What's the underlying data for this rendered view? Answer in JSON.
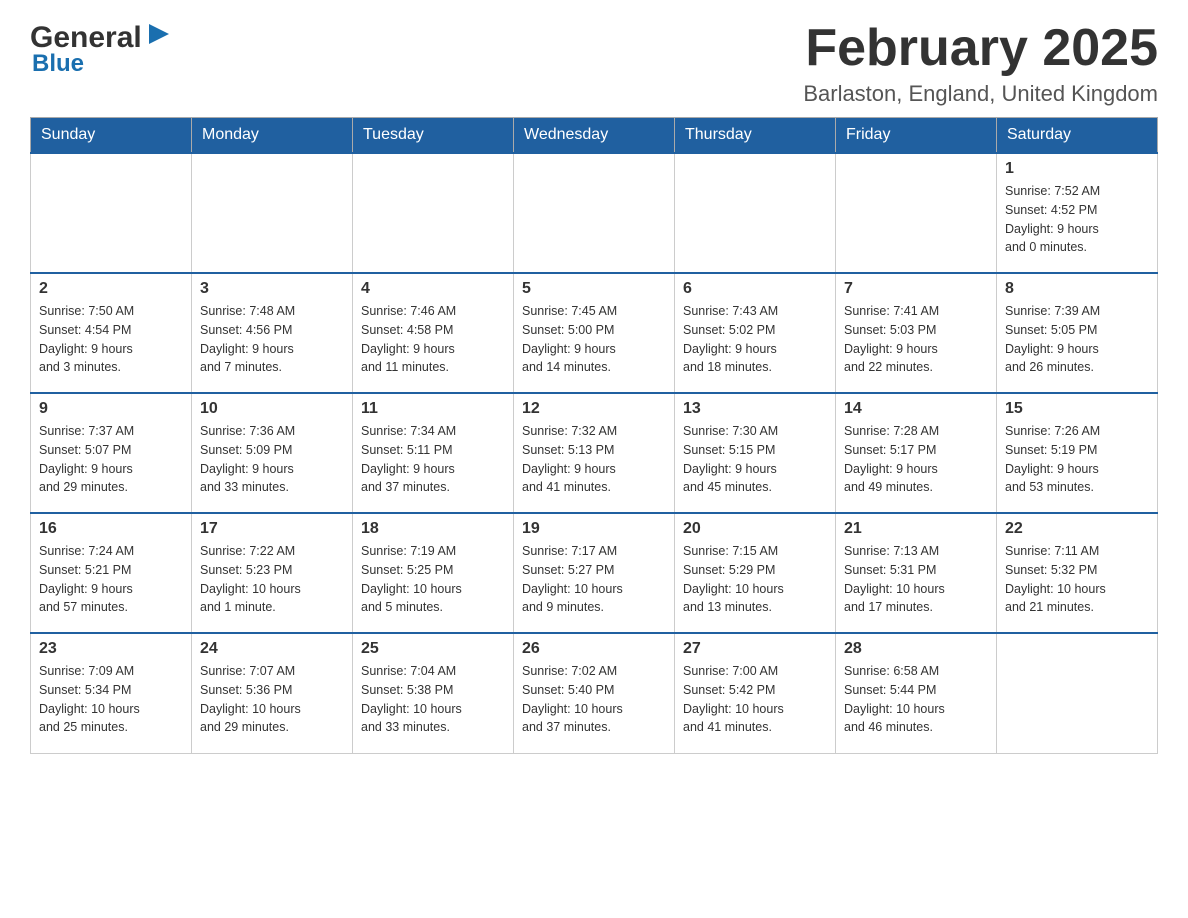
{
  "header": {
    "logo_general": "General",
    "logo_blue": "Blue",
    "month_title": "February 2025",
    "location": "Barlaston, England, United Kingdom"
  },
  "days_of_week": [
    "Sunday",
    "Monday",
    "Tuesday",
    "Wednesday",
    "Thursday",
    "Friday",
    "Saturday"
  ],
  "weeks": [
    [
      {
        "day": "",
        "info": ""
      },
      {
        "day": "",
        "info": ""
      },
      {
        "day": "",
        "info": ""
      },
      {
        "day": "",
        "info": ""
      },
      {
        "day": "",
        "info": ""
      },
      {
        "day": "",
        "info": ""
      },
      {
        "day": "1",
        "info": "Sunrise: 7:52 AM\nSunset: 4:52 PM\nDaylight: 9 hours\nand 0 minutes."
      }
    ],
    [
      {
        "day": "2",
        "info": "Sunrise: 7:50 AM\nSunset: 4:54 PM\nDaylight: 9 hours\nand 3 minutes."
      },
      {
        "day": "3",
        "info": "Sunrise: 7:48 AM\nSunset: 4:56 PM\nDaylight: 9 hours\nand 7 minutes."
      },
      {
        "day": "4",
        "info": "Sunrise: 7:46 AM\nSunset: 4:58 PM\nDaylight: 9 hours\nand 11 minutes."
      },
      {
        "day": "5",
        "info": "Sunrise: 7:45 AM\nSunset: 5:00 PM\nDaylight: 9 hours\nand 14 minutes."
      },
      {
        "day": "6",
        "info": "Sunrise: 7:43 AM\nSunset: 5:02 PM\nDaylight: 9 hours\nand 18 minutes."
      },
      {
        "day": "7",
        "info": "Sunrise: 7:41 AM\nSunset: 5:03 PM\nDaylight: 9 hours\nand 22 minutes."
      },
      {
        "day": "8",
        "info": "Sunrise: 7:39 AM\nSunset: 5:05 PM\nDaylight: 9 hours\nand 26 minutes."
      }
    ],
    [
      {
        "day": "9",
        "info": "Sunrise: 7:37 AM\nSunset: 5:07 PM\nDaylight: 9 hours\nand 29 minutes."
      },
      {
        "day": "10",
        "info": "Sunrise: 7:36 AM\nSunset: 5:09 PM\nDaylight: 9 hours\nand 33 minutes."
      },
      {
        "day": "11",
        "info": "Sunrise: 7:34 AM\nSunset: 5:11 PM\nDaylight: 9 hours\nand 37 minutes."
      },
      {
        "day": "12",
        "info": "Sunrise: 7:32 AM\nSunset: 5:13 PM\nDaylight: 9 hours\nand 41 minutes."
      },
      {
        "day": "13",
        "info": "Sunrise: 7:30 AM\nSunset: 5:15 PM\nDaylight: 9 hours\nand 45 minutes."
      },
      {
        "day": "14",
        "info": "Sunrise: 7:28 AM\nSunset: 5:17 PM\nDaylight: 9 hours\nand 49 minutes."
      },
      {
        "day": "15",
        "info": "Sunrise: 7:26 AM\nSunset: 5:19 PM\nDaylight: 9 hours\nand 53 minutes."
      }
    ],
    [
      {
        "day": "16",
        "info": "Sunrise: 7:24 AM\nSunset: 5:21 PM\nDaylight: 9 hours\nand 57 minutes."
      },
      {
        "day": "17",
        "info": "Sunrise: 7:22 AM\nSunset: 5:23 PM\nDaylight: 10 hours\nand 1 minute."
      },
      {
        "day": "18",
        "info": "Sunrise: 7:19 AM\nSunset: 5:25 PM\nDaylight: 10 hours\nand 5 minutes."
      },
      {
        "day": "19",
        "info": "Sunrise: 7:17 AM\nSunset: 5:27 PM\nDaylight: 10 hours\nand 9 minutes."
      },
      {
        "day": "20",
        "info": "Sunrise: 7:15 AM\nSunset: 5:29 PM\nDaylight: 10 hours\nand 13 minutes."
      },
      {
        "day": "21",
        "info": "Sunrise: 7:13 AM\nSunset: 5:31 PM\nDaylight: 10 hours\nand 17 minutes."
      },
      {
        "day": "22",
        "info": "Sunrise: 7:11 AM\nSunset: 5:32 PM\nDaylight: 10 hours\nand 21 minutes."
      }
    ],
    [
      {
        "day": "23",
        "info": "Sunrise: 7:09 AM\nSunset: 5:34 PM\nDaylight: 10 hours\nand 25 minutes."
      },
      {
        "day": "24",
        "info": "Sunrise: 7:07 AM\nSunset: 5:36 PM\nDaylight: 10 hours\nand 29 minutes."
      },
      {
        "day": "25",
        "info": "Sunrise: 7:04 AM\nSunset: 5:38 PM\nDaylight: 10 hours\nand 33 minutes."
      },
      {
        "day": "26",
        "info": "Sunrise: 7:02 AM\nSunset: 5:40 PM\nDaylight: 10 hours\nand 37 minutes."
      },
      {
        "day": "27",
        "info": "Sunrise: 7:00 AM\nSunset: 5:42 PM\nDaylight: 10 hours\nand 41 minutes."
      },
      {
        "day": "28",
        "info": "Sunrise: 6:58 AM\nSunset: 5:44 PM\nDaylight: 10 hours\nand 46 minutes."
      },
      {
        "day": "",
        "info": ""
      }
    ]
  ]
}
